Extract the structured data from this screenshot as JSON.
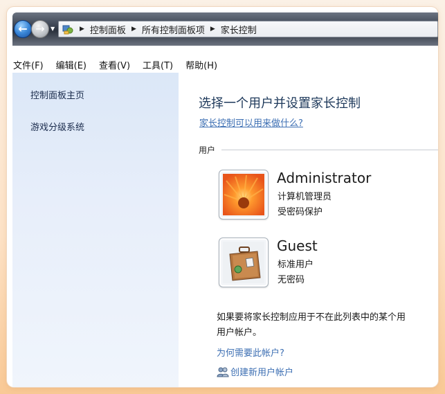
{
  "breadcrumb": {
    "items": [
      "控制面板",
      "所有控制面板项",
      "家长控制"
    ]
  },
  "menu": {
    "items": [
      "文件(F)",
      "编辑(E)",
      "查看(V)",
      "工具(T)",
      "帮助(H)"
    ]
  },
  "sidebar": {
    "items": [
      {
        "label": "控制面板主页"
      },
      {
        "label": "游戏分级系统"
      }
    ]
  },
  "main": {
    "title": "选择一个用户并设置家长控制",
    "help_link": "家长控制可以用来做什么?",
    "section_label": "用户",
    "users": [
      {
        "name": "Administrator",
        "role": "计算机管理员",
        "status": "受密码保护",
        "avatar": "orange-flower-icon"
      },
      {
        "name": "Guest",
        "role": "标准用户",
        "status": "无密码",
        "avatar": "suitcase-icon"
      }
    ],
    "note_line1": "如果要将家长控制应用于不在此列表中的某个用",
    "note_line2": "用户帐户。",
    "why_link": "为何需要此帐户?",
    "create_link": "创建新用户帐户"
  },
  "colors": {
    "link": "#3d6fb3",
    "title": "#1e395b",
    "sidebar_bg": "#dbe7f7"
  }
}
